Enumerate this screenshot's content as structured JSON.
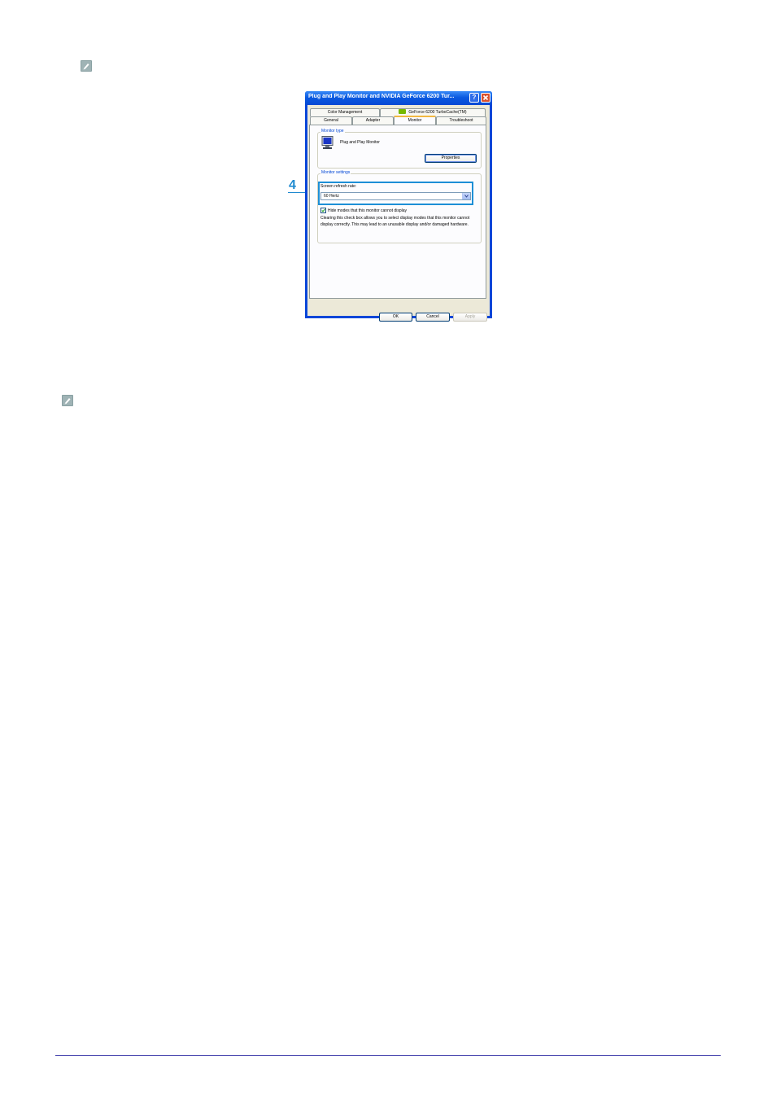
{
  "dialog": {
    "title": "Plug and Play Monitor and NVIDIA GeForce 6200 Tur...",
    "help_glyph": "?",
    "close_glyph": "✕",
    "tabs_row1": [
      "Color Management",
      "GeForce 6200 TurboCache(TM)"
    ],
    "tabs_row2": [
      "General",
      "Adapter",
      "Monitor",
      "Troubleshoot"
    ],
    "active_tab": "Monitor",
    "monitor_type": {
      "label": "Monitor type",
      "name": "Plug and Play Monitor",
      "properties_label": "Properties"
    },
    "monitor_settings": {
      "label": "Monitor settings",
      "refresh_label": "Screen refresh rate:",
      "refresh_value": "60 Hertz",
      "hide_modes_label": "Hide modes that this monitor cannot display",
      "hide_modes_checked": true,
      "description": "Clearing this check box allows you to select display modes that this monitor cannot display correctly. This may lead to an unusable display and/or damaged hardware."
    },
    "buttons": {
      "ok": "OK",
      "cancel": "Cancel",
      "apply": "Apply"
    }
  },
  "callout": {
    "number": "4"
  },
  "icons": {
    "note": "note-icon",
    "monitor": "monitor-icon",
    "nvidia": "nvidia-icon"
  }
}
